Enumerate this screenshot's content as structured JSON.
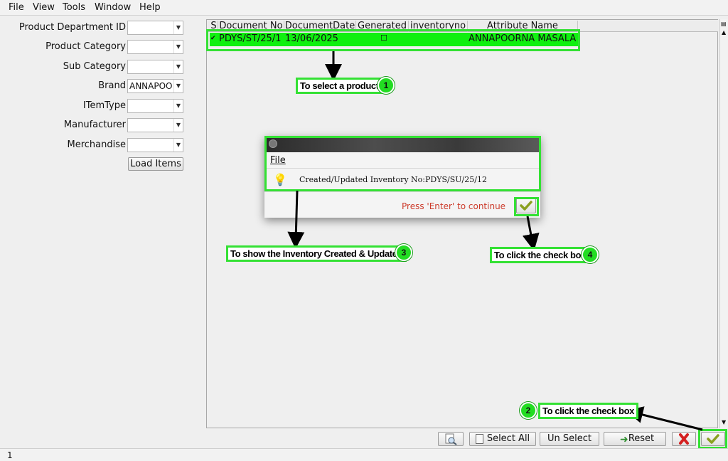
{
  "menu": {
    "file": "File",
    "view": "View",
    "tools": "Tools",
    "window": "Window",
    "help": "Help"
  },
  "filters": [
    {
      "label": "Product Department ID",
      "value": ""
    },
    {
      "label": "Product Category",
      "value": ""
    },
    {
      "label": "Sub Category",
      "value": ""
    },
    {
      "label": "Brand",
      "value": "ANNAPOO"
    },
    {
      "label": "ITemType",
      "value": ""
    },
    {
      "label": "Manufacturer",
      "value": ""
    },
    {
      "label": "Merchandise",
      "value": ""
    }
  ],
  "load_items": "Load Items",
  "grid": {
    "columns": [
      "S",
      "Document No",
      "DocumentDate",
      "Generated",
      "inventoryno",
      "Attribute Name"
    ],
    "rows": [
      {
        "s": "✔",
        "document_no": "PDYS/ST/25/1",
        "date": "13/06/2025",
        "generated": "☐",
        "inventoryno": "",
        "attribute": "ANNAPOORNA MASALA"
      }
    ]
  },
  "dialog": {
    "menu_file": "File",
    "message": "Created/Updated Inventory No:PDYS/SU/25/12",
    "prompt": "Press 'Enter' to continue"
  },
  "toolbar": {
    "select_all": "Select All",
    "un_select": "Un Select",
    "reset": "Reset"
  },
  "annotations": [
    {
      "text": "To select a product",
      "num": "1"
    },
    {
      "text": "To click the check box",
      "num": "2"
    },
    {
      "text": "To show the Inventory Created & Updated",
      "num": "3"
    },
    {
      "text": "To click the check box",
      "num": "4"
    }
  ],
  "status_text": "1",
  "colors": {
    "highlight": "#34e134",
    "row": "#10f010",
    "prompt": "#cc3b2b"
  }
}
